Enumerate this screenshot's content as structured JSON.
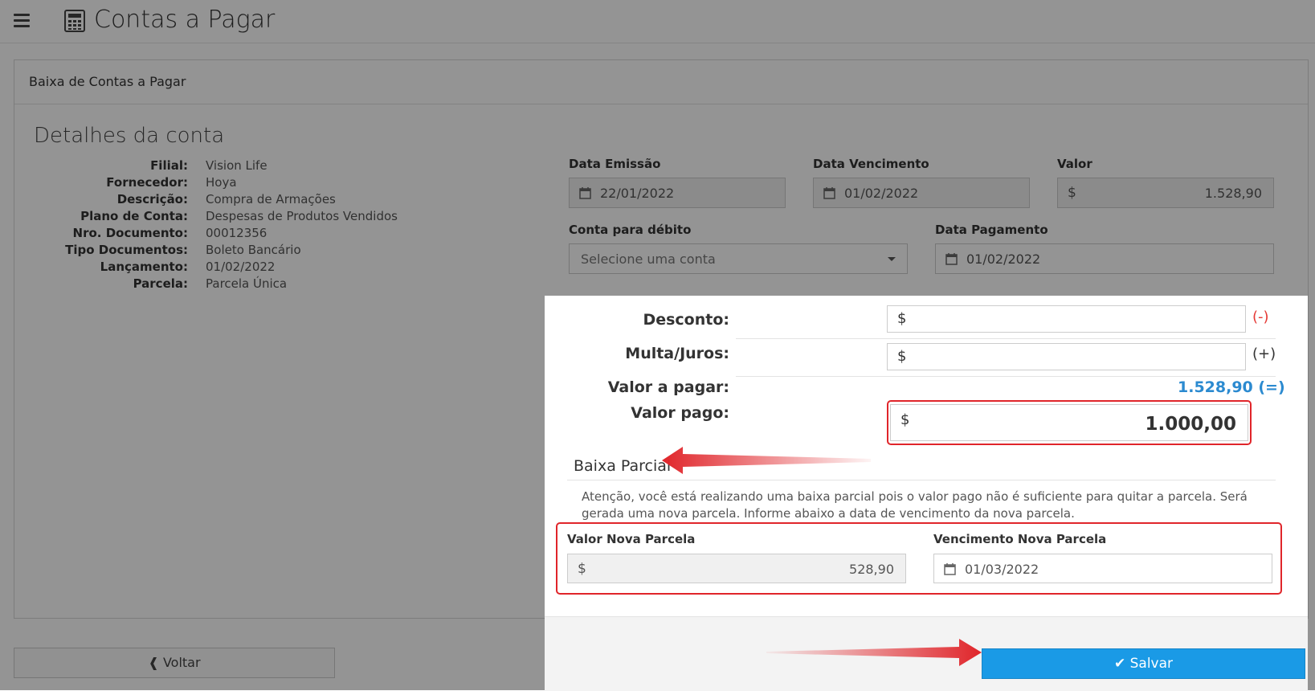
{
  "header": {
    "title": "Contas a Pagar",
    "menu_icon": "hamburger-icon",
    "app_icon": "calculator-icon"
  },
  "panel": {
    "title": "Baixa de Contas a Pagar",
    "section_title": "Detalhes da conta"
  },
  "details": [
    {
      "label": "Filial:",
      "value": "Vision Life"
    },
    {
      "label": "Fornecedor:",
      "value": "Hoya"
    },
    {
      "label": "Descrição:",
      "value": "Compra de Armações"
    },
    {
      "label": "Plano de Conta:",
      "value": "Despesas de Produtos Vendidos"
    },
    {
      "label": "Nro. Documento:",
      "value": "00012356"
    },
    {
      "label": "Tipo Documentos:",
      "value": "Boleto Bancário"
    },
    {
      "label": "Lançamento:",
      "value": "01/02/2022"
    },
    {
      "label": "Parcela:",
      "value": "Parcela Única"
    }
  ],
  "fields": {
    "data_emissao": {
      "label": "Data Emissão",
      "value": "22/01/2022"
    },
    "data_vencimento": {
      "label": "Data Vencimento",
      "value": "01/02/2022"
    },
    "valor": {
      "label": "Valor",
      "currency": "$",
      "value": "1.528,90"
    },
    "conta_debito": {
      "label": "Conta para débito",
      "placeholder": "Selecione uma conta"
    },
    "data_pagamento": {
      "label": "Data Pagamento",
      "value": "01/02/2022"
    }
  },
  "voltar_label": "Voltar",
  "modal": {
    "desconto": {
      "label": "Desconto:",
      "currency": "$",
      "sign": "(-)"
    },
    "multa": {
      "label": "Multa/Juros:",
      "currency": "$",
      "sign": "(+)"
    },
    "valor_a_pagar": {
      "label": "Valor a pagar:",
      "value": "1.528,90 (=)"
    },
    "valor_pago": {
      "label": "Valor pago:",
      "currency": "$",
      "value": "1.000,00"
    },
    "baixa_parcial": {
      "title": "Baixa Parcial",
      "text": "Atenção, você está realizando uma baixa parcial pois o valor pago não é suficiente para quitar a parcela. Será gerada uma nova parcela. Informe abaixo a data de vencimento da nova parcela."
    },
    "nova_parcela": {
      "label": "Valor Nova Parcela",
      "currency": "$",
      "value": "528,90"
    },
    "vencimento_nova": {
      "label": "Vencimento Nova Parcela",
      "value": "01/03/2022"
    },
    "salvar_label": "Salvar"
  },
  "colors": {
    "accent": "#1a9ae6",
    "highlight": "#e0252a",
    "link": "#2b8ad0"
  }
}
